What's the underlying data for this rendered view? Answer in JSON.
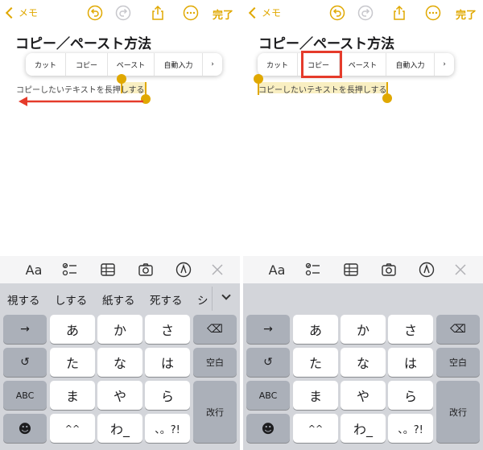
{
  "colors": {
    "accent": "#e0a800",
    "highlight": "#f9efc2",
    "arrow": "#e53b2b",
    "box": "#e53b2b"
  },
  "panels": [
    {
      "back_label": "メモ",
      "done_label": "完了",
      "note_title": "コピー／ペースト方法",
      "menu": [
        "カット",
        "コピー",
        "ペースト",
        "自動入力",
        "›"
      ],
      "body_text": "コピーしたいテキストを長押しする",
      "selected_text": "する",
      "candidates": [
        "視する",
        "しする",
        "紙する",
        "死する",
        "シ"
      ],
      "toolbar_aa": "Aa",
      "keys": {
        "arrow": "→",
        "a": "あ",
        "ka": "か",
        "sa": "さ",
        "del": "⌫",
        "undo": "↺",
        "ta": "た",
        "na": "な",
        "ha": "は",
        "space": "空白",
        "abc": "ABC",
        "ma": "ま",
        "ya": "や",
        "ra": "ら",
        "ret": "改行",
        "emoji": "☻",
        "hat": "^^",
        "wa": "わ_",
        "punct": "、。?!"
      }
    },
    {
      "back_label": "メモ",
      "done_label": "完了",
      "note_title": "コピー／ペースト方法",
      "menu": [
        "カット",
        "コピー",
        "ペースト",
        "自動入力",
        "›"
      ],
      "body_text": "コピーしたいテキストを長押しする",
      "toolbar_aa": "Aa",
      "keys": {
        "arrow": "→",
        "a": "あ",
        "ka": "か",
        "sa": "さ",
        "del": "⌫",
        "undo": "↺",
        "ta": "た",
        "na": "な",
        "ha": "は",
        "space": "空白",
        "abc": "ABC",
        "ma": "ま",
        "ya": "や",
        "ra": "ら",
        "ret": "改行",
        "emoji": "☻",
        "hat": "^^",
        "wa": "わ_",
        "punct": "、。?!"
      }
    }
  ]
}
